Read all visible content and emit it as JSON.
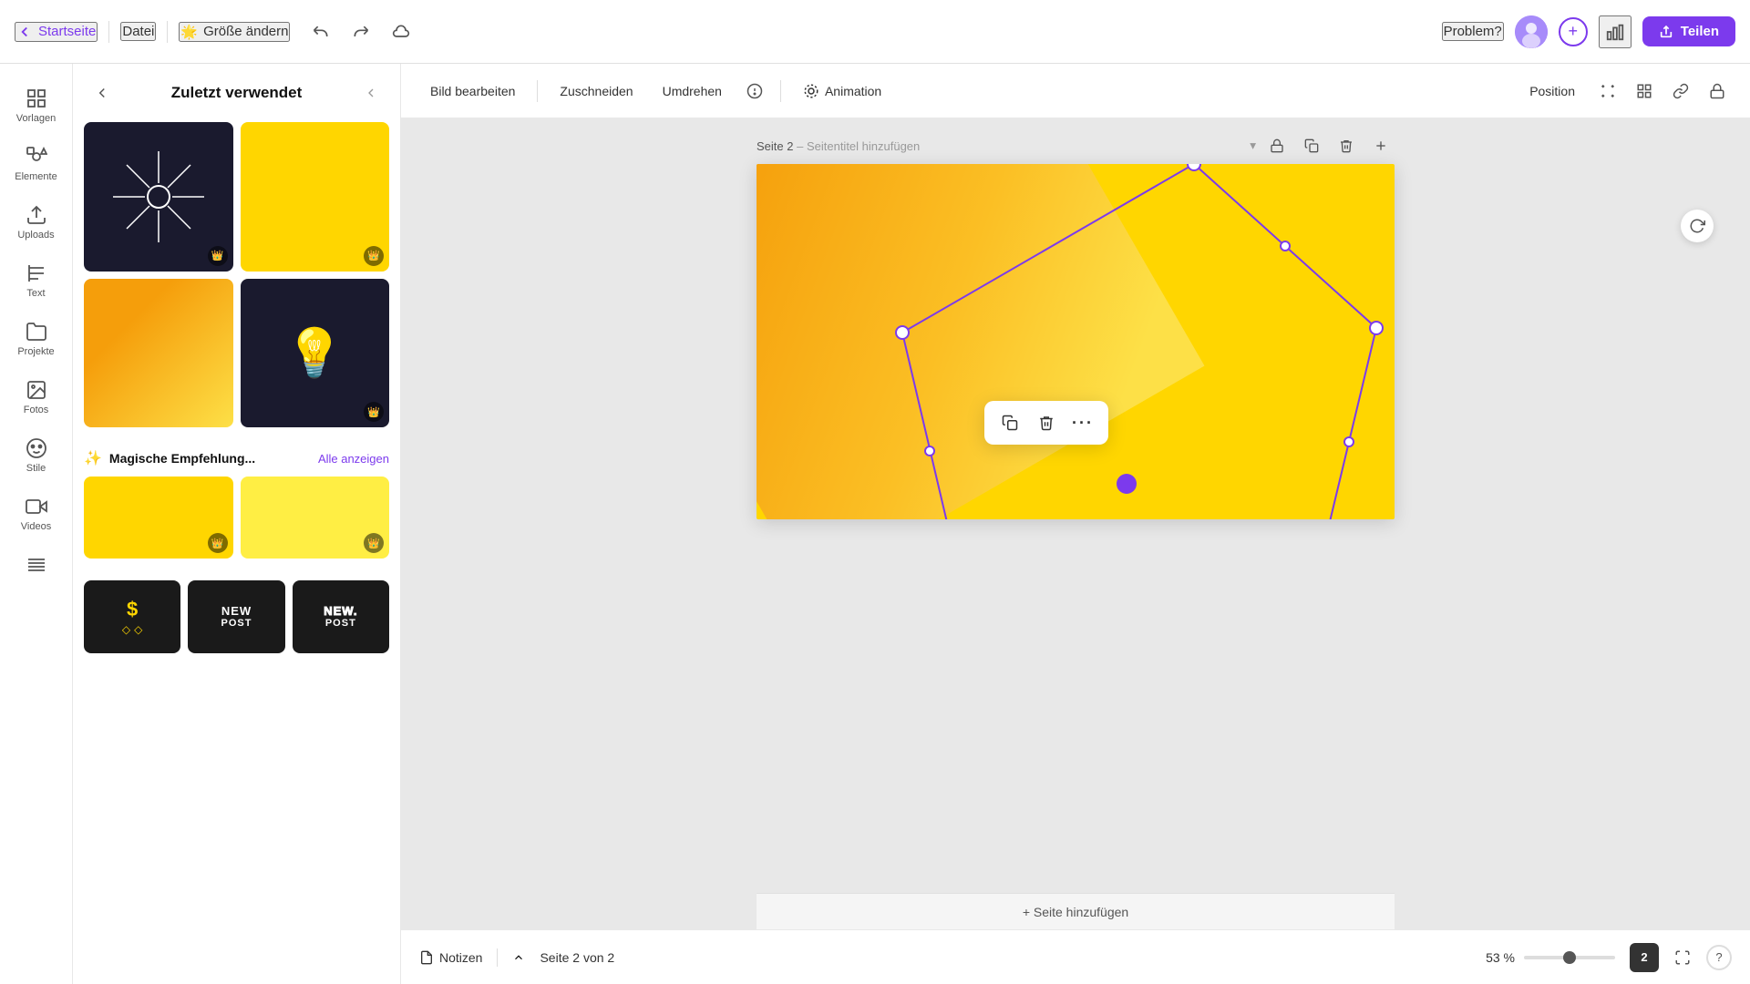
{
  "header": {
    "home_label": "Startseite",
    "file_label": "Datei",
    "size_label": "Größe ändern",
    "size_icon": "🌟",
    "problem_label": "Problem?",
    "share_label": "Teilen",
    "undo_label": "↩",
    "redo_label": "↪",
    "cloud_label": "☁"
  },
  "sidebar": {
    "items": [
      {
        "id": "vorlagen",
        "label": "Vorlagen",
        "icon": "grid"
      },
      {
        "id": "elemente",
        "label": "Elemente",
        "icon": "shapes"
      },
      {
        "id": "uploads",
        "label": "Uploads",
        "icon": "upload"
      },
      {
        "id": "text",
        "label": "Text",
        "icon": "text"
      },
      {
        "id": "projekte",
        "label": "Projekte",
        "icon": "folder"
      },
      {
        "id": "fotos",
        "label": "Fotos",
        "icon": "image"
      },
      {
        "id": "stile",
        "label": "Stile",
        "icon": "palette"
      },
      {
        "id": "videos",
        "label": "Videos",
        "icon": "video"
      }
    ]
  },
  "left_panel": {
    "title": "Zuletzt verwendet",
    "back_icon": "‹",
    "hide_icon": "◀"
  },
  "toolbar": {
    "edit_image": "Bild bearbeiten",
    "crop": "Zuschneiden",
    "flip": "Umdrehen",
    "animation": "Animation",
    "position": "Position"
  },
  "page": {
    "label": "Seite 2",
    "title_placeholder": "Seitentitel hinzufügen"
  },
  "context_menu": {
    "copy_icon": "⧉",
    "delete_icon": "🗑",
    "more_icon": "···"
  },
  "add_page": {
    "label": "+ Seite hinzufügen"
  },
  "status_bar": {
    "notes_label": "Notizen",
    "page_count": "Seite 2 von 2",
    "zoom_pct": "53 %"
  },
  "magic_section": {
    "title": "Magische Empfehlung...",
    "show_all": "Alle anzeigen"
  },
  "text_items": [
    {
      "label": "$",
      "style": "dollar"
    },
    {
      "label": "NEW POST",
      "style": "block"
    },
    {
      "label": "NEW. POST",
      "style": "outline"
    }
  ]
}
